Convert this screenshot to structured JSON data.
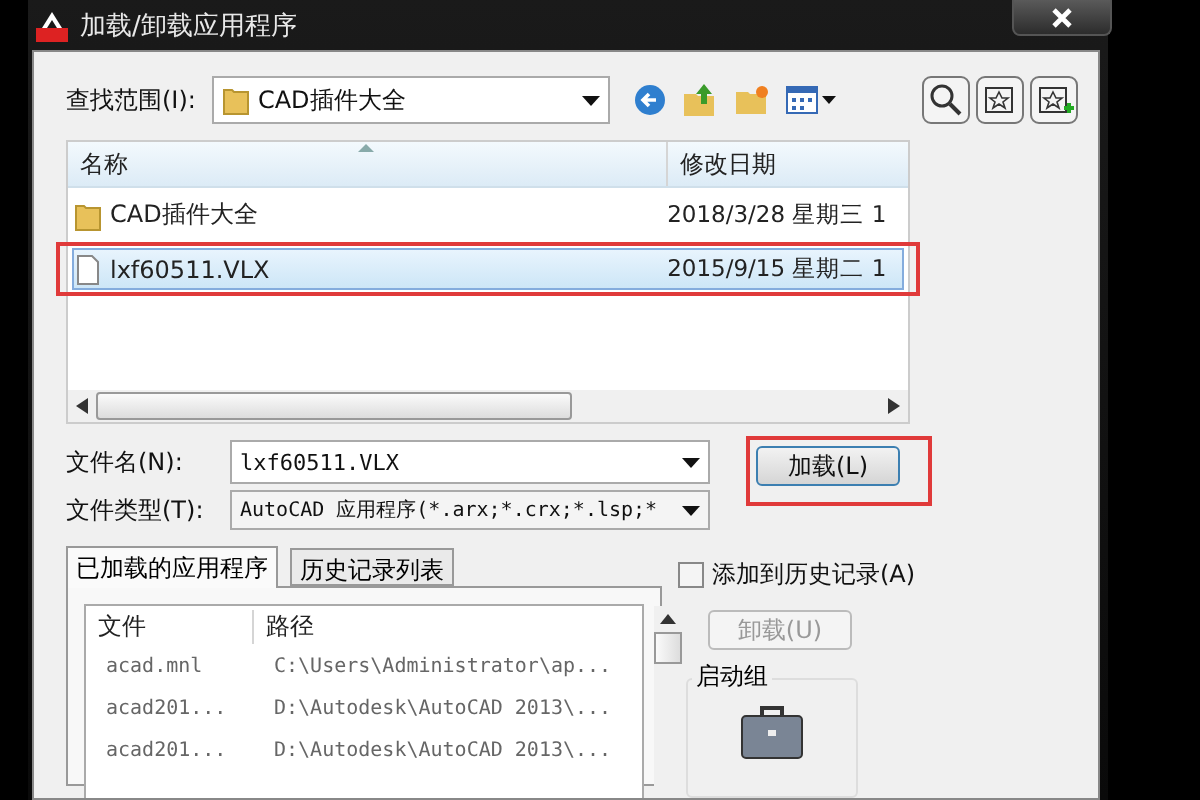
{
  "window": {
    "title": "加载/卸载应用程序"
  },
  "look_in": {
    "label": "查找范围(I):",
    "value": "CAD插件大全"
  },
  "file_list": {
    "columns": [
      "名称",
      "修改日期"
    ],
    "rows": [
      {
        "kind": "folder",
        "name": "CAD插件大全",
        "date": "2018/3/28 星期三 1",
        "selected": false,
        "highlighted": false
      },
      {
        "kind": "file",
        "name": "lxf60511.VLX",
        "date": "2015/9/15 星期二 1",
        "selected": true,
        "highlighted": true
      }
    ]
  },
  "file_name": {
    "label": "文件名(N):",
    "value": "lxf60511.VLX"
  },
  "file_type": {
    "label": "文件类型(T):",
    "value": "AutoCAD 应用程序(*.arx;*.crx;*.lsp;*"
  },
  "load_button": {
    "label": "加载(L)",
    "highlighted": true
  },
  "tabs": [
    {
      "label": "已加载的应用程序",
      "selected": true
    },
    {
      "label": "历史记录列表",
      "selected": false
    }
  ],
  "loaded_apps": {
    "columns": [
      "文件",
      "路径"
    ],
    "rows": [
      {
        "file": "acad.mnl",
        "path": "C:\\Users\\Administrator\\ap..."
      },
      {
        "file": "acad201...",
        "path": "D:\\Autodesk\\AutoCAD 2013\\..."
      },
      {
        "file": "acad201...",
        "path": "D:\\Autodesk\\AutoCAD 2013\\..."
      }
    ]
  },
  "add_to_history": {
    "label": "添加到历史记录(A)",
    "checked": false
  },
  "unload_button": {
    "label": "卸载(U)",
    "disabled": true
  },
  "startup_group": {
    "label": "启动组"
  }
}
